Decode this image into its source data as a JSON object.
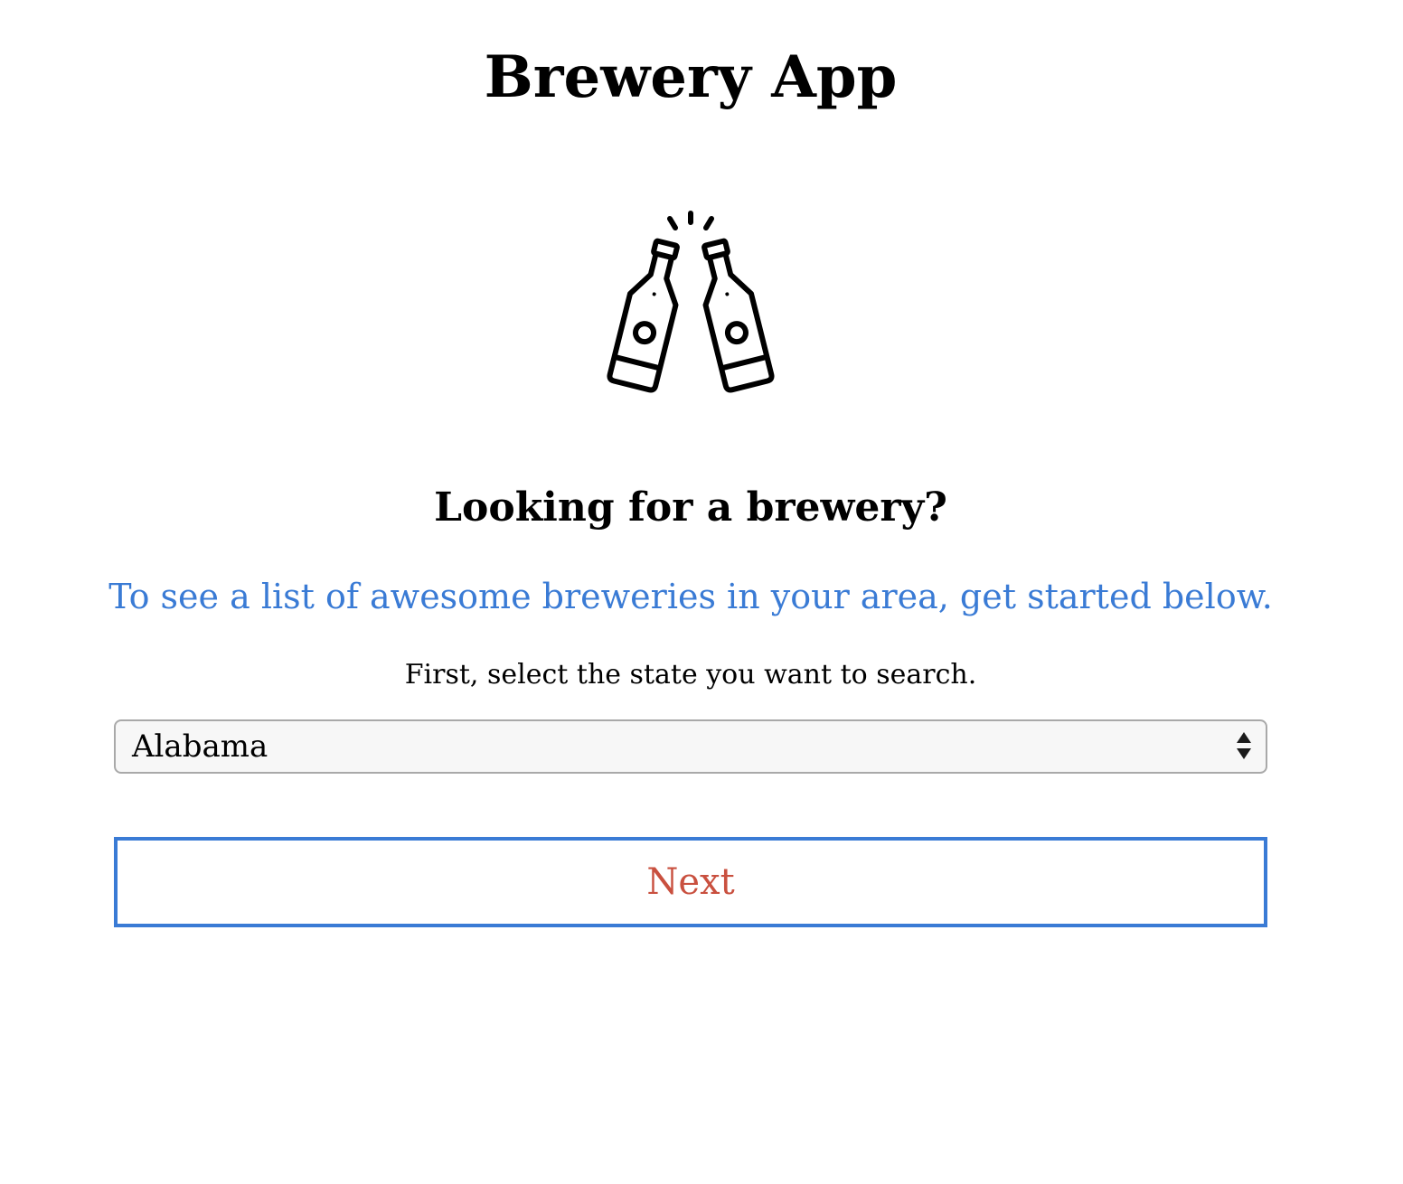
{
  "header": {
    "title": "Brewery App"
  },
  "logo": {
    "icon": "beer-bottles-cheers-icon"
  },
  "main": {
    "heading": "Looking for a brewery?",
    "tagline": "To see a list of awesome breweries in your area, get started below.",
    "instruction": "First, select the state you want to search.",
    "state_select": {
      "value": "Alabama",
      "icon": "select-arrows-icon"
    },
    "next_label": "Next"
  },
  "colors": {
    "tagline": "#3a7bd5",
    "next_text": "#c9503f",
    "next_border": "#3a7bd5",
    "select_background": "#f7f7f7",
    "select_border": "#a9a9a9"
  }
}
